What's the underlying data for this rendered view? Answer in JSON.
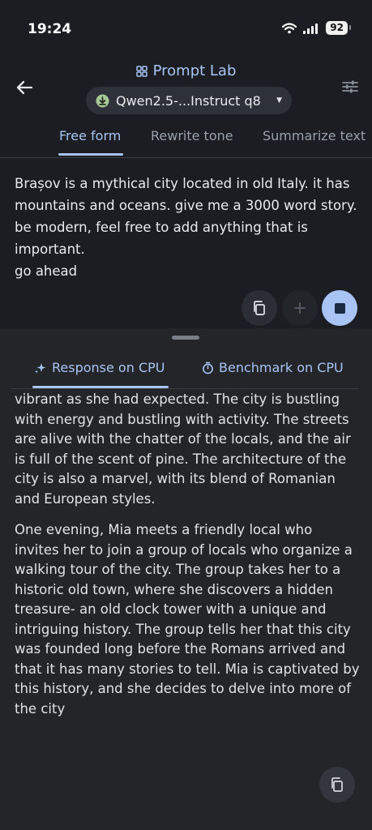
{
  "status_bar": {
    "time": "19:24",
    "battery": "92"
  },
  "header": {
    "title": "Prompt Lab",
    "model": "Qwen2.5-...Instruct q8"
  },
  "tabs": [
    {
      "label": "Free form",
      "active": true
    },
    {
      "label": "Rewrite tone",
      "active": false
    },
    {
      "label": "Summarize text",
      "active": false
    }
  ],
  "prompt": {
    "text": "Brașov is a mythical city located in old Italy. it has mountains and oceans. give me a 3000 word story. be modern, feel free to add anything that is important.\ngo ahead"
  },
  "response_tabs": [
    {
      "label": "Response on CPU",
      "active": true
    },
    {
      "label": "Benchmark on CPU",
      "active": false
    }
  ],
  "response": {
    "paragraphs": [
      "vibrant as she had expected. The city is bustling with energy and bustling with activity. The streets are alive with the chatter of the locals, and the air is full of the scent of pine. The architecture of the city is also a marvel, with its blend of Romanian and European styles.",
      "One evening, Mia meets a friendly local who invites her to join a group of locals who organize a walking tour of the city. The group takes her to a historic old town, where she discovers a hidden treasure- an old clock tower with a unique and intriguing history. The group tells her that this city was founded long before the Romans arrived and that it has many stories to tell. Mia is captivated by this history, and she decides to delve into more of the city"
    ]
  },
  "colors": {
    "accent": "#a8c4f4",
    "background": "#1b1d22",
    "sheet": "#232529"
  }
}
